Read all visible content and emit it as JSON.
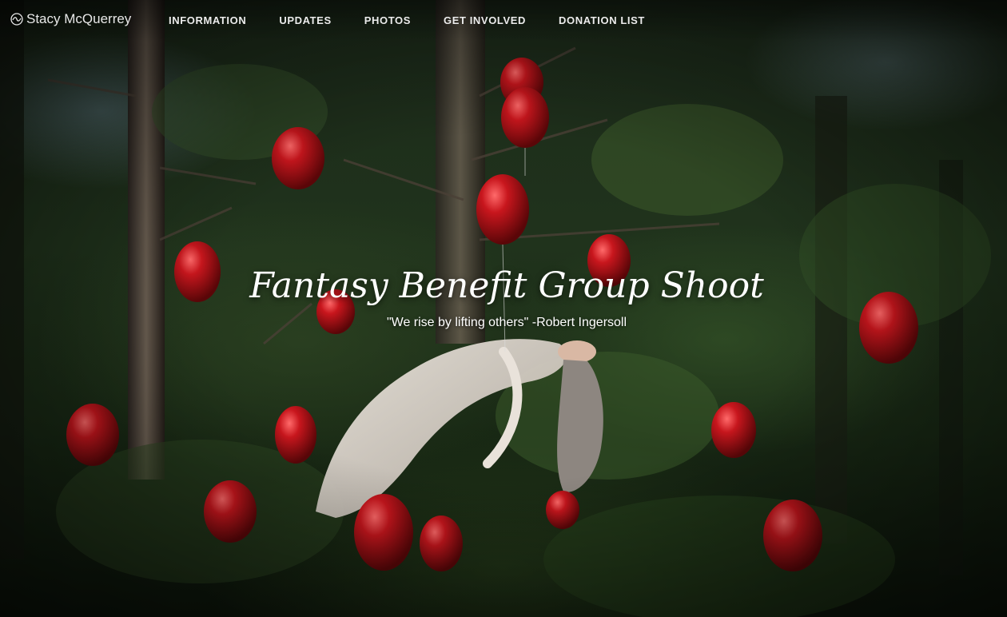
{
  "site": {
    "logo_text": "Stacy McQuerrey",
    "logo_icon": "circle-wave-icon"
  },
  "nav": {
    "items": [
      {
        "label": "INFORMATION"
      },
      {
        "label": "UPDATES"
      },
      {
        "label": "PHOTOS"
      },
      {
        "label": "GET INVOLVED"
      },
      {
        "label": "DONATION LIST"
      }
    ]
  },
  "hero": {
    "title": "Fantasy Benefit Group Shoot",
    "quote": "\"We rise by lifting others\" -Robert Ingersoll",
    "image": "forest-scene-with-floating-woman-and-red-balloons"
  },
  "colors": {
    "balloon_red": "#b0141a",
    "forest_green": "#20331c",
    "text": "#ffffff"
  }
}
